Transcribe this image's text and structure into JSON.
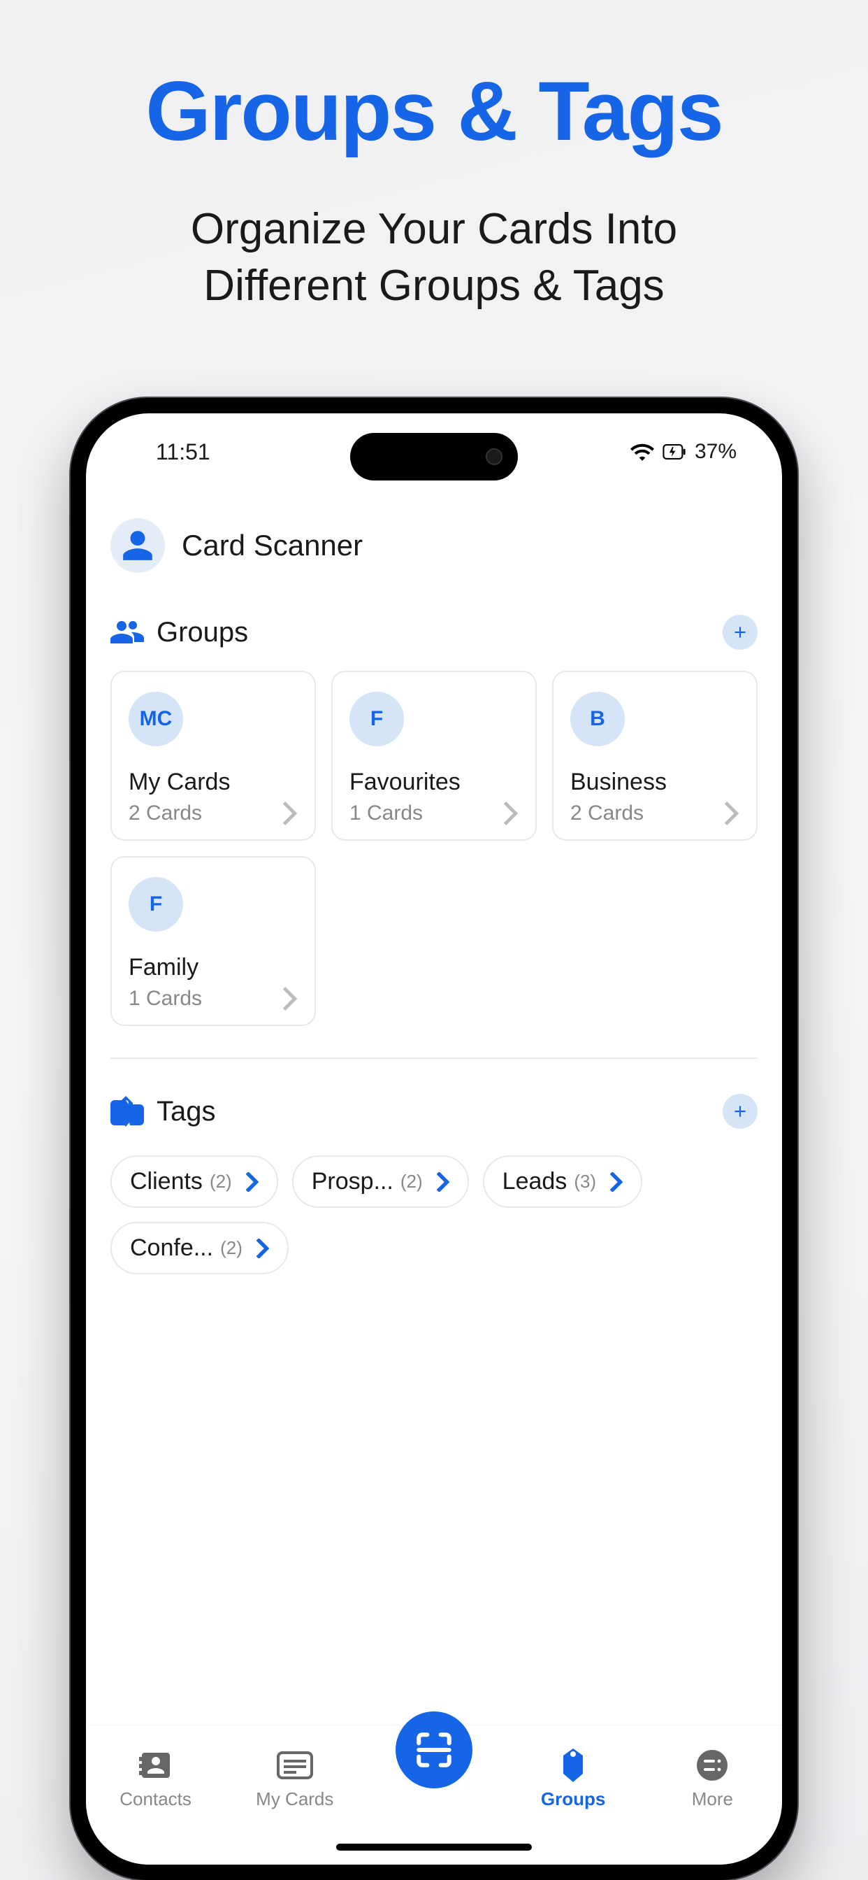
{
  "promo": {
    "title": "Groups & Tags",
    "subtitle_line1": "Organize Your Cards Into",
    "subtitle_line2": "Different Groups & Tags"
  },
  "status": {
    "time": "11:51",
    "battery": "37%"
  },
  "app": {
    "title": "Card Scanner"
  },
  "sections": {
    "groups_label": "Groups",
    "tags_label": "Tags"
  },
  "groups": [
    {
      "initials": "MC",
      "name": "My Cards",
      "count": "2 Cards"
    },
    {
      "initials": "F",
      "name": "Favourites",
      "count": "1 Cards"
    },
    {
      "initials": "B",
      "name": "Business",
      "count": "2 Cards"
    },
    {
      "initials": "F",
      "name": "Family",
      "count": "1 Cards"
    }
  ],
  "tags": [
    {
      "name": "Clients",
      "count": "(2)"
    },
    {
      "name": "Prosp...",
      "count": "(2)"
    },
    {
      "name": "Leads",
      "count": "(3)"
    },
    {
      "name": "Confe...",
      "count": "(2)"
    }
  ],
  "nav": {
    "contacts": "Contacts",
    "mycards": "My Cards",
    "groups": "Groups",
    "more": "More"
  }
}
